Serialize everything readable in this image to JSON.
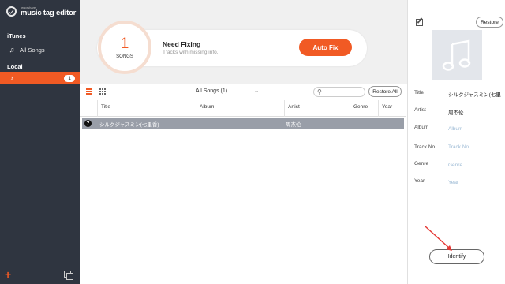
{
  "app": {
    "logo_small": "tenorshare",
    "logo_main": "music tag editor"
  },
  "sidebar": {
    "itunes_title": "iTunes",
    "all_songs": "All Songs",
    "local_title": "Local",
    "local_item": {
      "label": "",
      "count": "1"
    }
  },
  "banner": {
    "count": "1",
    "count_label": "SONGS",
    "title": "Need Fixing",
    "subtitle": "Tracks with missing info.",
    "autofix": "Auto Fix"
  },
  "toolbar": {
    "filter_value": "All Songs (1)",
    "search_placeholder": "",
    "restore_all": "Restore All"
  },
  "table": {
    "columns": [
      "Title",
      "Album",
      "Artist",
      "Genre",
      "Year"
    ],
    "rows": [
      {
        "title": "シルクジャスミン(七里香)",
        "album": "",
        "artist": "周杰伦",
        "genre": "",
        "year": ""
      }
    ]
  },
  "details": {
    "restore": "Restore",
    "labels": {
      "title": "Title",
      "artist": "Artist",
      "album": "Album",
      "track": "Track No",
      "genre": "Genre",
      "year": "Year"
    },
    "values": {
      "title": "シルクジャスミン(七里",
      "artist": "周杰伦"
    },
    "placeholders": {
      "album": "Album",
      "track": "Track No.",
      "genre": "Genre",
      "year": "Year"
    },
    "identify": "Identify"
  },
  "colors": {
    "accent": "#f15a24",
    "sidebar": "#2f3540",
    "selected_row": "#999ea8"
  },
  "icons": [
    "check-circle-icon",
    "music-note-icon",
    "folder-music-icon",
    "plus-icon",
    "copy-icon",
    "search-icon",
    "menu-icon",
    "minimize-icon",
    "maximize-icon",
    "close-icon",
    "list-view-icon",
    "grid-view-icon",
    "chevron-down-icon",
    "question-icon",
    "edit-icon",
    "album-art-icon",
    "arrow-icon"
  ]
}
